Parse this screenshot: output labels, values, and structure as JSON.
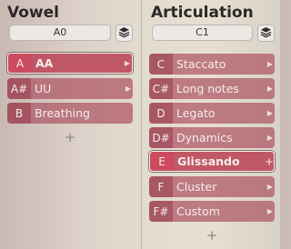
{
  "vowel": {
    "title": "Vowel",
    "key_value": "A0",
    "items": [
      {
        "key": "A",
        "label": "AA",
        "selected": true
      },
      {
        "key": "A#",
        "label": "UU",
        "selected": false
      },
      {
        "key": "B",
        "label": "Breathing",
        "selected": false
      }
    ]
  },
  "articulation": {
    "title": "Articulation",
    "key_value": "C1",
    "items": [
      {
        "key": "C",
        "label": "Staccato",
        "selected": false
      },
      {
        "key": "C#",
        "label": "Long notes",
        "selected": false
      },
      {
        "key": "D",
        "label": "Legato",
        "selected": false
      },
      {
        "key": "D#",
        "label": "Dynamics",
        "selected": false
      },
      {
        "key": "E",
        "label": "Glissando",
        "selected": true
      },
      {
        "key": "F",
        "label": "Cluster",
        "selected": false
      },
      {
        "key": "F#",
        "label": "Custom",
        "selected": false
      }
    ]
  },
  "icons": {
    "layers": "layers-icon",
    "arrow": "chevron-right-icon",
    "add": "plus-icon"
  },
  "colors": {
    "item_bg": "#ad5462",
    "item_selected_bg": "#be5060",
    "item_text": "#f4eded"
  }
}
